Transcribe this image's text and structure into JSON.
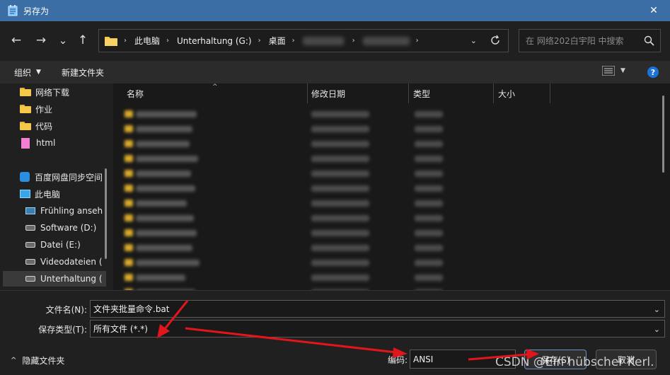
{
  "window": {
    "title": "另存为",
    "close_glyph": "✕"
  },
  "nav": {
    "back_glyph": "←",
    "forward_glyph": "→",
    "recent_glyph": "⌄",
    "up_glyph": "↑",
    "breadcrumb": [
      "此电脑",
      "Unterhaltung (G:)",
      "桌面"
    ],
    "search_placeholder": "在 网络202白宇阳 中搜索"
  },
  "toolbar": {
    "organize_label": "组织",
    "new_folder_label": "新建文件夹",
    "help_glyph": "?"
  },
  "sidebar": {
    "quick": [
      {
        "label": "网络下载",
        "icon": "folder-icon"
      },
      {
        "label": "作业",
        "icon": "folder-icon"
      },
      {
        "label": "代码",
        "icon": "folder-icon"
      },
      {
        "label": "html",
        "icon": "pink-folder-icon"
      }
    ],
    "tree": [
      {
        "label": "百度网盘同步空间",
        "icon": "cloud-sync-icon"
      },
      {
        "label": "此电脑",
        "icon": "computer-icon"
      },
      {
        "label": "Frühling anseh",
        "icon": "network-drive-icon"
      },
      {
        "label": "Software (D:)",
        "icon": "drive-icon"
      },
      {
        "label": "Datei (E:)",
        "icon": "drive-icon"
      },
      {
        "label": "Videodateien (",
        "icon": "drive-icon"
      },
      {
        "label": "Unterhaltung (",
        "icon": "drive-icon"
      }
    ]
  },
  "columns": {
    "name": "名称",
    "modified": "修改日期",
    "type": "类型",
    "size": "大小"
  },
  "form": {
    "filename_label": "文件名(N):",
    "filename_value": "文件夹批量命令.bat",
    "filetype_label": "保存类型(T):",
    "filetype_value": "所有文件  (*.*)",
    "encoding_label": "编码:",
    "encoding_value": "ANSI",
    "save_label": "保存(S)",
    "cancel_label": "取消",
    "hide_folders_label": "隐藏文件夹",
    "hide_caret": "^"
  },
  "watermark": "CSDN @Ein hübscher Kerl.",
  "colors": {
    "titlebar": "#3a6ea5",
    "arrow": "#e0161c",
    "folder": "#f5c84a",
    "help": "#1a73d9"
  }
}
